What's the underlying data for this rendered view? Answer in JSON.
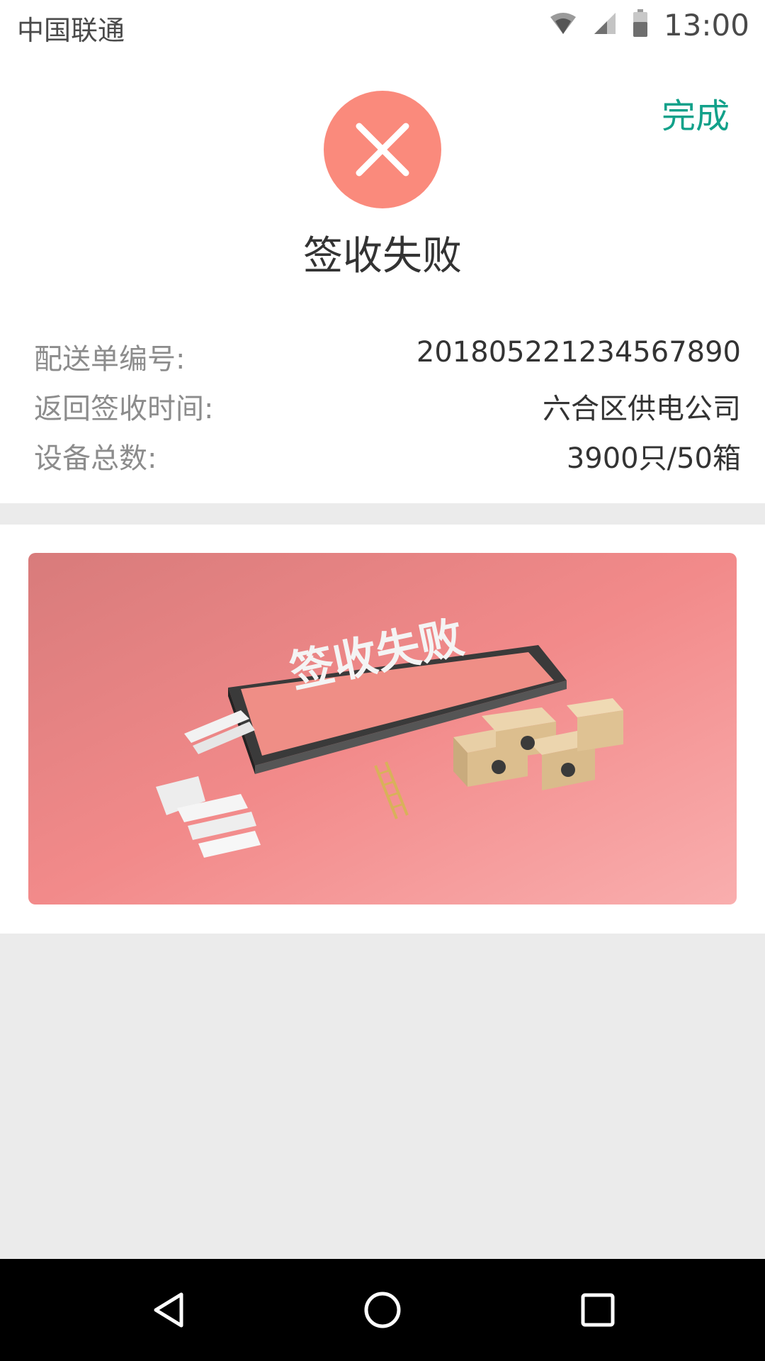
{
  "status_bar": {
    "carrier": "中国联通",
    "time": "13:00",
    "icons": [
      "wifi-icon",
      "signal-icon",
      "battery-icon"
    ]
  },
  "header": {
    "done_label": "完成"
  },
  "result": {
    "icon": "close-icon",
    "status_color": "#fa8a7c",
    "title": "签收失败"
  },
  "info": [
    {
      "label": "配送单编号:",
      "value": "201805221234567890"
    },
    {
      "label": "返回签收时间:",
      "value": "六合区供电公司"
    },
    {
      "label": "设备总数:",
      "value": "3900只/50箱"
    }
  ],
  "banner": {
    "text": "签收失败"
  },
  "nav_bar": {
    "icons": [
      "back-icon",
      "home-icon",
      "recents-icon"
    ]
  },
  "colors": {
    "accent": "#12a18a",
    "fail": "#fa8a7c"
  }
}
